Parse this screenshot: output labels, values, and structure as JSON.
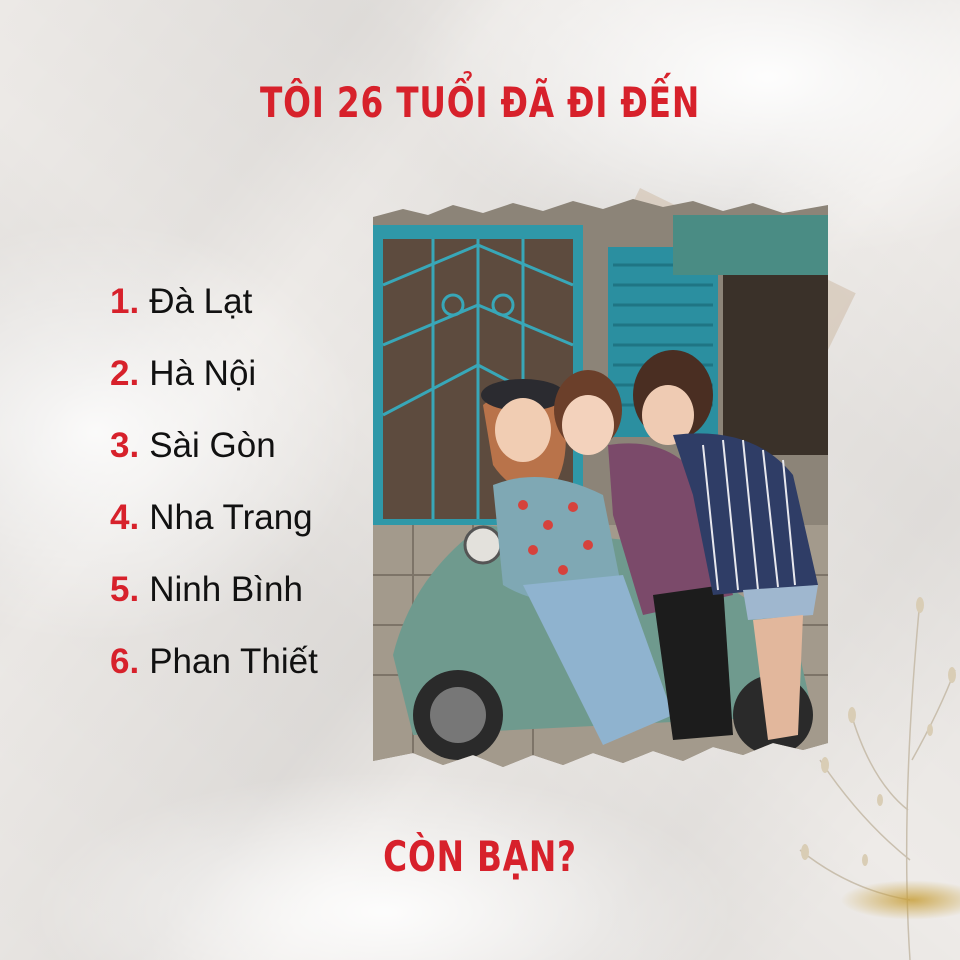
{
  "title": "TÔI 26 TUỔI ĐÃ ĐI ĐẾN",
  "places": [
    {
      "num": "1.",
      "name": "Đà Lạt"
    },
    {
      "num": "2.",
      "name": "Hà Nội"
    },
    {
      "num": "3.",
      "name": "Sài Gòn"
    },
    {
      "num": "4.",
      "name": "Nha Trang"
    },
    {
      "num": "5.",
      "name": "Ninh Bình"
    },
    {
      "num": "6.",
      "name": "Phan Thiết"
    }
  ],
  "question": "CÒN BẠN?",
  "colors": {
    "accent": "#d7212b",
    "text": "#111111",
    "paper": "#eeebe8"
  },
  "photo": {
    "description_icon": "photo-three-friends-motorbike"
  }
}
